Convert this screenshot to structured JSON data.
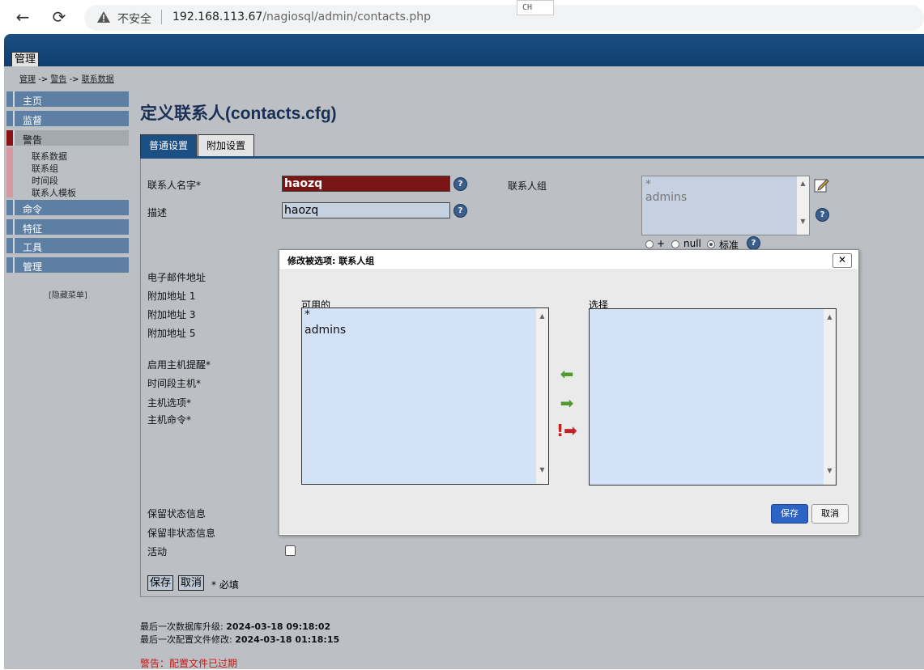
{
  "browser": {
    "back_icon": "←",
    "reload_icon": "⟳",
    "security_label": "不安全",
    "url_host": "192.168.113.67",
    "url_path": "/nagiosql/admin/contacts.php",
    "ime_label": "CH"
  },
  "banner": {
    "tab_label": "管理"
  },
  "breadcrumb": {
    "item1": "管理",
    "sep": "->",
    "item2": "警告",
    "item3": "联系数据"
  },
  "menu": {
    "items": [
      "主页",
      "监督",
      "警告",
      "命令",
      "特征",
      "工具",
      "管理"
    ],
    "active_index": 2,
    "subitems": [
      "联系数据",
      "联系组",
      "时间段",
      "联系人模板"
    ],
    "hide_label": "[隐藏菜单]"
  },
  "page": {
    "title": "定义联系人(contacts.cfg)",
    "tabs": [
      "普通设置",
      "附加设置"
    ],
    "active_tab": 0
  },
  "form": {
    "name_label": "联系人名字*",
    "name_value": "haozq",
    "desc_label": "描述",
    "desc_value": "haozq",
    "group_label": "联系人组",
    "group_options": [
      "*",
      "admins"
    ],
    "group_radio": [
      "+",
      "null",
      "标准"
    ],
    "group_radio_selected": 2,
    "email_label": "电子邮件地址",
    "addr1_label": "附加地址 1",
    "addr3_label": "附加地址 3",
    "addr5_label": "附加地址 5",
    "host_notif_label": "启用主机提醒*",
    "host_period_label": "时间段主机*",
    "host_options_label": "主机选项*",
    "host_command_label": "主机命令*",
    "retain_status_label": "保留状态信息",
    "retain_nonstatus_label": "保留非状态信息",
    "active_label": "活动",
    "save_label": "保存",
    "cancel_label": "取消",
    "required_note": "* 必填"
  },
  "footer": {
    "db_update_label": "最后一次数据库升级:",
    "db_update_value": "2024-03-18 09:18:02",
    "cfg_update_label": "最后一次配置文件修改:",
    "cfg_update_value": "2024-03-18 01:18:15",
    "warning": "警告：配置文件已过期"
  },
  "dialog": {
    "title": "修改被选项: 联系人组",
    "close_icon": "✕",
    "available_label": "可用的",
    "available_items": [
      "*",
      "admins"
    ],
    "selected_label": "选择",
    "selected_items": [],
    "add_icon": "⬅",
    "remove_icon": "➡",
    "exclude_icon": "!➡",
    "save_label": "保存",
    "cancel_label": "取消"
  },
  "colors": {
    "banner": "#1c4f84",
    "name_field_bg": "#7a1515",
    "field_bg": "#c5d0e0",
    "listbox_bg": "#d4e2f7",
    "warning": "#c41818",
    "dialog_save": "#2c63c4"
  }
}
